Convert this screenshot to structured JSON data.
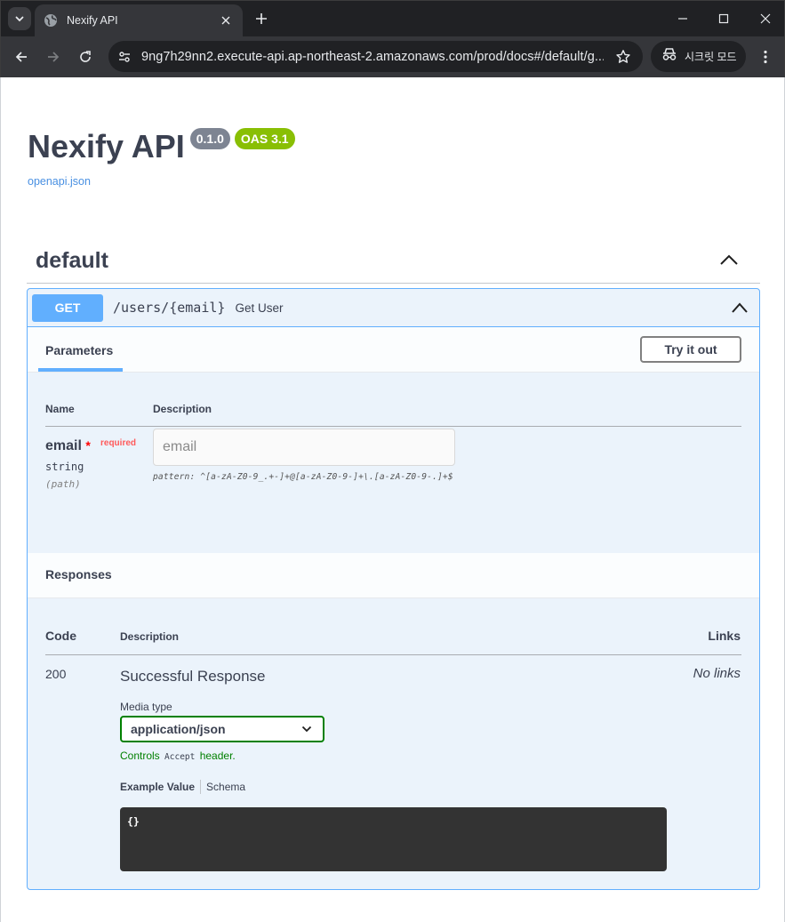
{
  "browser": {
    "tab_title": "Nexify API",
    "url": "9ng7h29nn2.execute-api.ap-northeast-2.amazonaws.com/prod/docs#/default/g...",
    "incognito_label": "시크릿 모드",
    "icons": [
      "tab-search-icon",
      "globe-icon",
      "close-icon",
      "plus-icon",
      "minimize-icon",
      "maximize-icon",
      "window-close-icon",
      "back-icon",
      "forward-icon",
      "reload-icon",
      "site-settings-icon",
      "star-icon",
      "incognito-icon",
      "more-icon"
    ]
  },
  "api": {
    "title": "Nexify API",
    "version": "0.1.0",
    "oas": "OAS 3.1",
    "spec_link": "openapi.json"
  },
  "colors": {
    "get_method": "#61affe",
    "version_badge": "#7d8492",
    "oas_badge": "#89bf04",
    "success_green": "#008000",
    "required_red": "#ff0000"
  },
  "section": {
    "title": "default"
  },
  "operation": {
    "method": "GET",
    "path": "/users/{email}",
    "summary": "Get User",
    "parameters_tab": "Parameters",
    "try_it_out": "Try it out",
    "columns": {
      "name": "Name",
      "description": "Description"
    },
    "param": {
      "name": "email",
      "required_star": "*",
      "required": "required",
      "type": "string",
      "in": "(path)",
      "placeholder": "email",
      "pattern": "pattern: ^[a-zA-Z0-9_.+-]+@[a-zA-Z0-9-]+\\.[a-zA-Z0-9-.]+$"
    }
  },
  "responses": {
    "title": "Responses",
    "columns": {
      "code": "Code",
      "description": "Description",
      "links": "Links"
    },
    "row": {
      "code": "200",
      "description": "Successful Response",
      "links": "No links",
      "media_type_label": "Media type",
      "media_type": "application/json",
      "controls_prefix": "Controls",
      "controls_code": "Accept",
      "controls_suffix": "header.",
      "example_tab": "Example Value",
      "schema_tab": "Schema",
      "example_value": "{}"
    }
  }
}
